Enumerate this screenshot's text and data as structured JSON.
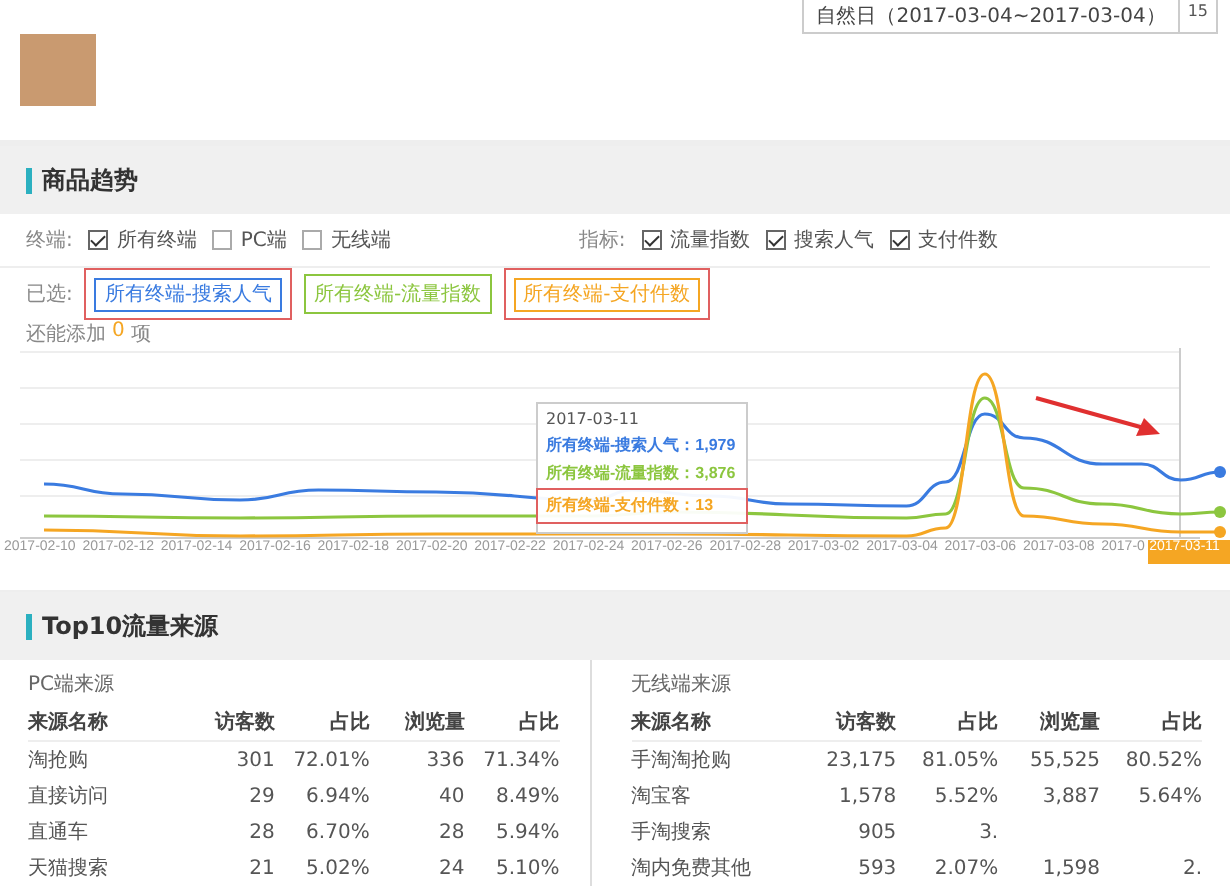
{
  "date_picker": {
    "value": "自然日（2017-03-04~2017-03-04）",
    "calendar": "15"
  },
  "trend": {
    "title": "商品趋势",
    "terminal_label": "终端:",
    "terminals": [
      {
        "label": "所有终端",
        "checked": true
      },
      {
        "label": "PC端",
        "checked": false
      },
      {
        "label": "无线端",
        "checked": false
      }
    ],
    "metric_label": "指标:",
    "metrics": [
      {
        "label": "流量指数",
        "checked": true
      },
      {
        "label": "搜索人气",
        "checked": true
      },
      {
        "label": "支付件数",
        "checked": true
      }
    ],
    "selected_label": "已选:",
    "selected_tags": [
      {
        "label": "所有终端-搜索人气",
        "color": "#3a7be0"
      },
      {
        "label": "所有终端-流量指数",
        "color": "#8cc63f"
      },
      {
        "label": "所有终端-支付件数",
        "color": "#f5a623"
      }
    ],
    "remaining": {
      "text": "还能添加",
      "count": "0",
      "unit": "项"
    },
    "x_labels": [
      {
        "label": "2017-02-10",
        "selected": false
      },
      {
        "label": "2017-02-12",
        "selected": false
      },
      {
        "label": "2017-02-14",
        "selected": false
      },
      {
        "label": "2017-02-16",
        "selected": false
      },
      {
        "label": "2017-02-18",
        "selected": false
      },
      {
        "label": "2017-02-20",
        "selected": false
      },
      {
        "label": "2017-02-22",
        "selected": false
      },
      {
        "label": "2017-02-24",
        "selected": false
      },
      {
        "label": "2017-02-26",
        "selected": false
      },
      {
        "label": "2017-02-28",
        "selected": false
      },
      {
        "label": "2017-03-02",
        "selected": false
      },
      {
        "label": "2017-03-04",
        "selected": false
      },
      {
        "label": "2017-03-06",
        "selected": false
      },
      {
        "label": "2017-03-08",
        "selected": false
      },
      {
        "label": "2017-0",
        "selected": false
      },
      {
        "label": "2017-03-11",
        "selected": true
      }
    ],
    "tooltip": {
      "date": "2017-03-11",
      "lines": [
        {
          "text": "所有终端-搜索人气：1,979",
          "color": "#3a7be0"
        },
        {
          "text": "所有终端-流量指数：3,876",
          "color": "#8cc63f"
        },
        {
          "text": "所有终端-支付件数：13",
          "color": "#f5a623"
        }
      ]
    }
  },
  "sources": {
    "title": "Top10流量来源",
    "tables": [
      {
        "title": "PC端来源",
        "columns": [
          "来源名称",
          "访客数",
          "占比",
          "浏览量",
          "占比"
        ],
        "rows": [
          [
            "淘抢购",
            "301",
            "72.01%",
            "336",
            "71.34%"
          ],
          [
            "直接访问",
            "29",
            "6.94%",
            "40",
            "8.49%"
          ],
          [
            "直通车",
            "28",
            "6.70%",
            "28",
            "5.94%"
          ],
          [
            "天猫搜索",
            "21",
            "5.02%",
            "24",
            "5.10%"
          ]
        ]
      },
      {
        "title": "无线端来源",
        "columns": [
          "来源名称",
          "访客数",
          "占比",
          "浏览量",
          "占比"
        ],
        "rows": [
          [
            "手淘淘抢购",
            "23,175",
            "81.05%",
            "55,525",
            "80.52%"
          ],
          [
            "淘宝客",
            "1,578",
            "5.52%",
            "3,887",
            "5.64%"
          ],
          [
            "手淘搜索",
            "905",
            "3."
          ],
          [
            "淘内免费其他",
            "593",
            "2.07%",
            "1,598",
            "2."
          ]
        ]
      }
    ]
  }
}
